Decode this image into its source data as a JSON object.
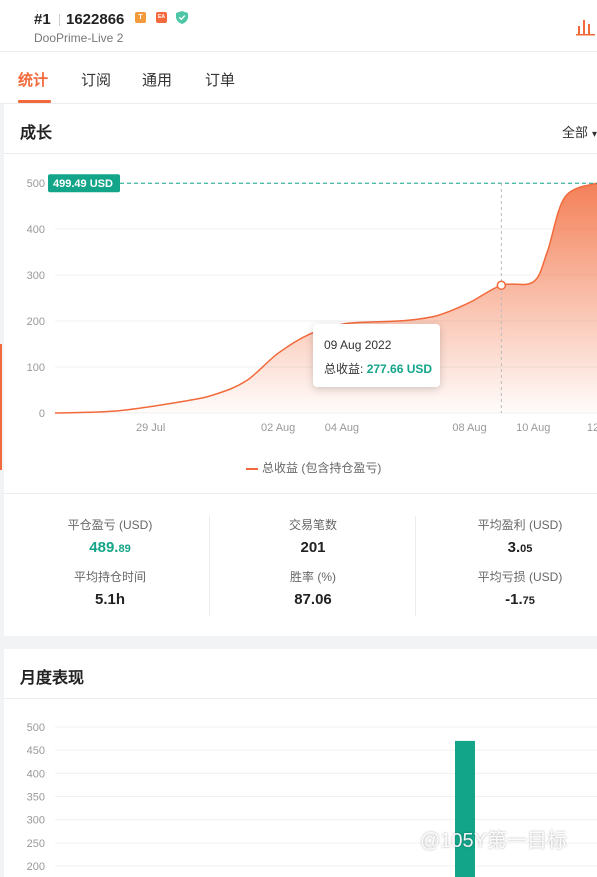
{
  "header": {
    "rank": "#1",
    "account": "1622866",
    "badge_t": "T",
    "badge_ea": "EA",
    "server": "DooPrime-Live 2"
  },
  "tabs": [
    {
      "label": "统计",
      "active": true
    },
    {
      "label": "订阅"
    },
    {
      "label": "通用"
    },
    {
      "label": "订单"
    }
  ],
  "growth": {
    "title": "成长",
    "filter": "全部"
  },
  "chart_data": [
    {
      "type": "area",
      "title": "",
      "ylim": [
        0,
        500
      ],
      "yticks": [
        0,
        100,
        200,
        300,
        400,
        500
      ],
      "xtick_labels": [
        "29 Jul",
        "02 Aug",
        "04 Aug",
        "08 Aug",
        "10 Aug",
        "12"
      ],
      "series": [
        {
          "name": "总收益 (包含持仓盈亏)",
          "color": "#f26a3b",
          "points": [
            {
              "x": "26 Jul",
              "y": 0
            },
            {
              "x": "28 Jul",
              "y": 5
            },
            {
              "x": "30 Jul",
              "y": 25
            },
            {
              "x": "31 Jul",
              "y": 40
            },
            {
              "x": "01 Aug",
              "y": 70
            },
            {
              "x": "02 Aug",
              "y": 130
            },
            {
              "x": "03 Aug",
              "y": 172
            },
            {
              "x": "04 Aug",
              "y": 193
            },
            {
              "x": "05 Aug",
              "y": 198
            },
            {
              "x": "06 Aug",
              "y": 201
            },
            {
              "x": "07 Aug",
              "y": 212
            },
            {
              "x": "08 Aug",
              "y": 240
            },
            {
              "x": "09 Aug",
              "y": 277.66
            },
            {
              "x": "10 Aug",
              "y": 285
            },
            {
              "x": "10 Aug",
              "y": 350
            },
            {
              "x": "11 Aug",
              "y": 470
            },
            {
              "x": "12 Aug",
              "y": 499.49
            }
          ]
        }
      ],
      "max_label": "499.49 USD",
      "tooltip": {
        "date": "09 Aug 2022",
        "label": "总收益:",
        "value": "277.66 USD"
      }
    },
    {
      "type": "bar",
      "title": "月度表现",
      "ylim": [
        200,
        500
      ],
      "yticks": [
        200,
        250,
        300,
        350,
        400,
        450,
        500
      ],
      "values": [
        470
      ],
      "color": "#13a589"
    }
  ],
  "legend_label": "总收益 (包含持仓盈亏)",
  "stats": [
    {
      "label": "平仓盈亏 (USD)",
      "int": "489.",
      "dec": "89",
      "green": true
    },
    {
      "label": "交易笔数",
      "int": "201",
      "dec": ""
    },
    {
      "label": "平均盈利 (USD)",
      "int": "3.",
      "dec": "05"
    },
    {
      "label": "平均持仓时间",
      "int": "5.1h",
      "dec": ""
    },
    {
      "label": "胜率 (%)",
      "int": "87.06",
      "dec": ""
    },
    {
      "label": "平均亏损 (USD)",
      "int": "-1.",
      "dec": "75"
    }
  ],
  "monthly": {
    "title": "月度表现"
  },
  "watermark": "@105Y第一目标"
}
